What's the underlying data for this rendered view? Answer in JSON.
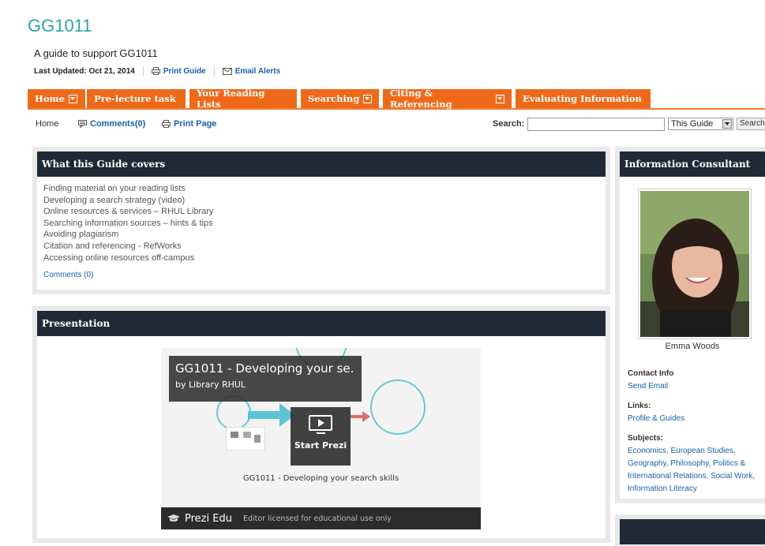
{
  "header": {
    "title": "GG1011",
    "description": "A guide to support GG1011",
    "last_updated": "Last Updated: Oct 21, 2014",
    "print_guide": "Print Guide",
    "email_alerts": "Email Alerts"
  },
  "tabs": [
    {
      "label": "Home",
      "dropdown": true
    },
    {
      "label": "Pre-lecture task",
      "dropdown": false
    },
    {
      "label": "Your Reading Lists",
      "dropdown": false
    },
    {
      "label": "Searching",
      "dropdown": true
    },
    {
      "label": "Citing & Referencing",
      "dropdown": true
    },
    {
      "label": "Evaluating Information",
      "dropdown": false
    }
  ],
  "subnav": {
    "home": "Home",
    "comments": "Comments(0)",
    "print_page": "Print Page",
    "search_label": "Search:",
    "search_value": "",
    "scope": "This Guide",
    "search_button": "Search"
  },
  "guide_box": {
    "title": "What this Guide covers",
    "items": [
      "Finding material on your reading lists",
      "Developing a search strategy (video)",
      "Online resources & services – RHUL Library",
      "Searching information sources – hints & tips",
      "Avoiding plagiarism",
      "Citation and referencing - RefWorks",
      "Accessing online resources off-campus"
    ],
    "comments": "Comments (0)"
  },
  "presentation": {
    "title": "Presentation",
    "prezi_title": "GG1011 - Developing your se...",
    "prezi_author": "by Library RHUL",
    "start": "Start Prezi",
    "caption": "GG1011 - Developing your search skills",
    "brand": "Prezi Edu",
    "license_note": "Editor licensed for educational use only"
  },
  "consultant": {
    "title": "Information Consultant",
    "name": "Emma Woods",
    "contact_heading": "Contact Info",
    "contact_link": "Send Email",
    "links_heading": "Links:",
    "links_link": "Profile & Guides",
    "subjects_heading": "Subjects:",
    "subjects_lines": [
      "Economics, European Studies,",
      "Geography, Philosophy, Politics &",
      "International Relations, Social Work,",
      "Information Literacy"
    ]
  },
  "colors": {
    "title_teal": "#2aa4a7",
    "tab_orange": "#ee6a1a",
    "box_header": "#1f2a36",
    "link_blue": "#1a5fa8"
  }
}
